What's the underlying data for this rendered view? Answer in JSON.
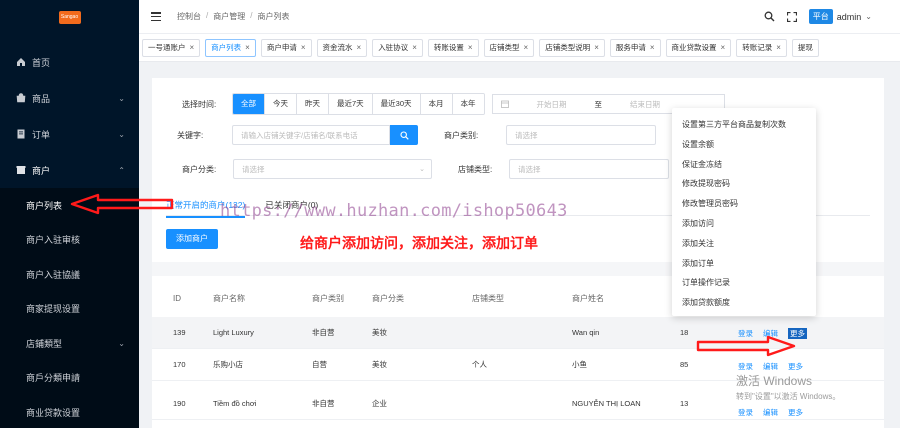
{
  "sidebar": {
    "logo_text": "Sangao",
    "items": [
      {
        "label": "首页"
      },
      {
        "label": "商品"
      },
      {
        "label": "订单"
      },
      {
        "label": "商户"
      }
    ],
    "merchant_sub": [
      {
        "label": "商户列表"
      },
      {
        "label": "商户入驻审核"
      },
      {
        "label": "商户入驻協議"
      },
      {
        "label": "商家提现设置"
      },
      {
        "label": "店鋪類型"
      },
      {
        "label": "商戶分類申請"
      },
      {
        "label": "商业贷款设置"
      }
    ]
  },
  "header": {
    "breadcrumb": [
      "控制台",
      "商户管理",
      "商户列表"
    ],
    "platform": "平台",
    "user": "admin"
  },
  "tabs": [
    "一号通账户",
    "商户列表",
    "商户申请",
    "资金流水",
    "入驻协议",
    "转账设置",
    "店铺类型",
    "店铺类型说明",
    "服务申请",
    "商业贷款设置",
    "转账记录",
    "提现"
  ],
  "filters": {
    "time_label": "选择时间:",
    "time_options": [
      "全部",
      "今天",
      "昨天",
      "最近7天",
      "最近30天",
      "本月",
      "本年"
    ],
    "date_start": "开始日期",
    "date_to": "至",
    "date_end": "结束日期",
    "keyword_label": "关键字:",
    "keyword_placeholder": "请输入店铺关键字/店铺名/联系电话",
    "merchant_category_label": "商户类别:",
    "merchant_category_placeholder": "请选择",
    "merchant_class_label": "商户分类:",
    "merchant_class_placeholder": "请选择",
    "store_type_label": "店铺类型:",
    "store_type_placeholder": "请选择"
  },
  "status_tabs": [
    "正常开启的商户(132)",
    "已关闭商户(0)"
  ],
  "add_button": "添加商户",
  "annotation": "给商户添加访问，添加关注，添加订单",
  "table": {
    "headers": [
      "ID",
      "商户名称",
      "商户类别",
      "商户分类",
      "店铺类型",
      "商户姓名"
    ],
    "rows": [
      {
        "id": "139",
        "name": "Light Luxury",
        "type": "非自营",
        "cat": "美妆",
        "store": "",
        "owner": "Wan qin",
        "phone": "18"
      },
      {
        "id": "170",
        "name": "乐购小店",
        "type": "自营",
        "cat": "美妆",
        "store": "个人",
        "owner": "小鱼",
        "phone": "85"
      },
      {
        "id": "190",
        "name": "Tiềm đồ chơi",
        "type": "非自营",
        "cat": "企业",
        "store": "",
        "owner": "NGUYỄN THỊ LOAN",
        "phone": "13"
      }
    ],
    "ops": {
      "login": "登录",
      "edit": "编辑",
      "more": "更多"
    }
  },
  "dropdown": [
    "设置第三方平台商品复制次数",
    "设置余额",
    "保证金冻结",
    "修改提现密码",
    "修改管理员密码",
    "添加访问",
    "添加关注",
    "添加订单",
    "订单操作记录",
    "添加贷款额度"
  ],
  "watermark": "https://www.huzhan.com/ishop50643",
  "windows_activation": {
    "title": "激活 Windows",
    "subtitle": "转到\"设置\"以激活 Windows。"
  },
  "colors": {
    "sidebar_bg": "#001529",
    "primary": "#1890ff",
    "annotation_red": "#ff1a1a"
  }
}
